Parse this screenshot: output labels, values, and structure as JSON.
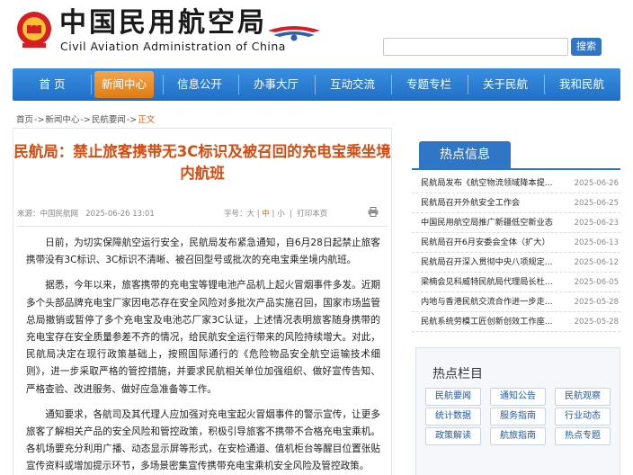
{
  "header": {
    "title": "中国民用航空局",
    "subtitle": "Civil Aviation Administration of China",
    "search_button": "搜索",
    "search_placeholder": ""
  },
  "nav": {
    "items": [
      {
        "label": "首 页",
        "active": false
      },
      {
        "label": "新闻中心",
        "active": true
      },
      {
        "label": "信息公开",
        "active": false
      },
      {
        "label": "办事大厅",
        "active": false
      },
      {
        "label": "互动交流",
        "active": false
      },
      {
        "label": "专题专栏",
        "active": false
      },
      {
        "label": "关于民航",
        "active": false
      },
      {
        "label": "我和民航",
        "active": false
      }
    ]
  },
  "breadcrumb": {
    "items": [
      "首页",
      "新闻中心",
      "民航要闻"
    ],
    "separator": "->",
    "current": "正文"
  },
  "article": {
    "title": "民航局：禁止旅客携带无3C标识及被召回的充电宝乘坐境内航班",
    "source": "来源：中国民航网",
    "date": "2025-06-26 13:01",
    "font_size_label": "字号：",
    "font_large": "大",
    "font_medium": "中",
    "font_small": "小",
    "print_label": "打印本页",
    "paragraphs": [
      "日前，为切实保障航空运行安全，民航局发布紧急通知，自6月28日起禁止旅客携带没有3C标识、3C标识不清晰、被召回型号或批次的充电宝乘坐境内航班。",
      "据悉，今年以来，旅客携带的充电宝等锂电池产品机上起火冒烟事件多发。近期多个头部品牌充电宝厂家因电芯存在安全风险对多批次产品实施召回，国家市场监管总局撤销或暂停了多个充电宝及电池芯厂家3C认证，上述情况表明旅客随身携带的充电宝存在安全质量参差不齐的情况，给民航安全运行带来的风险持续增大。对此，民航局决定在现行政策基础上，按照国际通行的《危险物品安全航空运输技术细则》，进一步采取严格的管控措施，并要求民航相关单位加强组织、做好宣传告知、严格查验、改进服务、做好应急准备等工作。",
      "通知要求，各航司及其代理人应加强对充电宝起火冒烟事件的警示宣传，让更多旅客了解相关产品的安全风险和管控政策，积极引导旅客不携带不合格充电宝乘机。各机场要充分利用广播、动态显示屏等形式，在安检通道、值机柜台等醒目位置张贴宣传资料或增加提示环节，多场景密集宣传携带充电宝乘机安全风险及管控政策。"
    ]
  },
  "hot_info": {
    "title": "热点信息",
    "items": [
      {
        "title": "民航局发布《航空物流领域降本提...",
        "date": "2025-06-26"
      },
      {
        "title": "民航局召开外航安全工作会",
        "date": "2025-06-25"
      },
      {
        "title": "中国民用航空局推广新疆低空新业态",
        "date": "2025-06-23"
      },
      {
        "title": "民航局召开6月安委会全体（扩大）",
        "date": "2025-06-13"
      },
      {
        "title": "民航局召开深入贯彻中央八项规定...",
        "date": "2025-06-12"
      },
      {
        "title": "梁楠会见科威特民航局代理局长杜...",
        "date": "2025-06-05"
      },
      {
        "title": "内地与香港民航交流合作进一步走...",
        "date": "2025-05-28"
      },
      {
        "title": "民航系统劳模工匠创新创效工作座...",
        "date": "2025-05-28"
      }
    ]
  },
  "hot_columns": {
    "title": "热点栏目",
    "items": [
      "民航要闻",
      "通知公告",
      "民航观察",
      "统计数据",
      "服务指南",
      "行业动态",
      "政策解读",
      "航旅指南",
      "热点专题"
    ]
  },
  "colors": {
    "nav_blue": "#2f77c6",
    "nav_active_orange": "#e07b12",
    "title_orange": "#d84b10",
    "logo_red": "#d61e25"
  }
}
